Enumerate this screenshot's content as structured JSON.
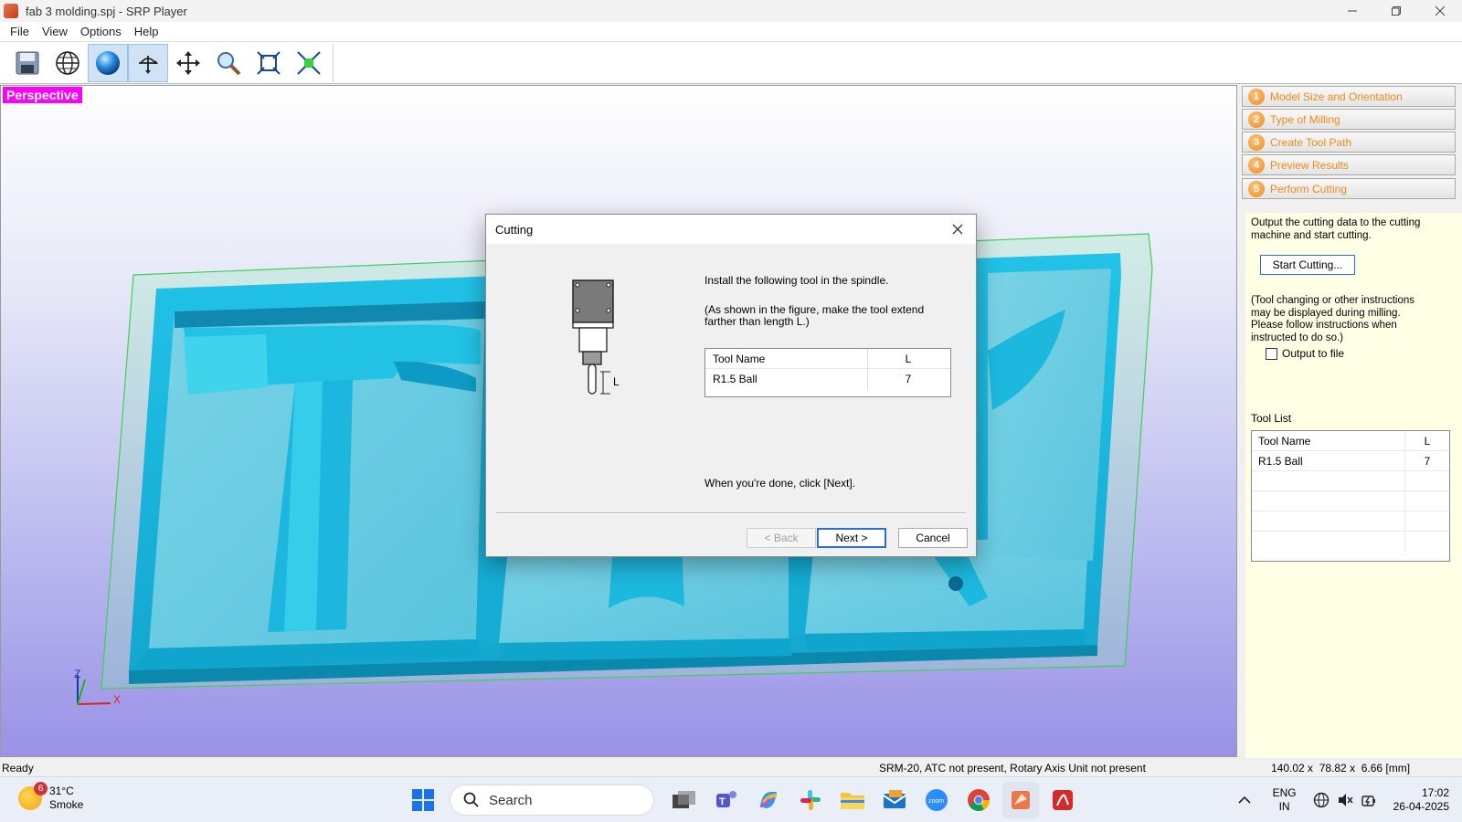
{
  "window": {
    "title": "fab 3 molding.spj - SRP Player"
  },
  "menu": [
    "File",
    "View",
    "Options",
    "Help"
  ],
  "toolbar": {
    "buttons": [
      "save-icon",
      "globe-icon",
      "sphere-render-icon",
      "rotate-view-icon",
      "pan-icon",
      "zoom-icon",
      "fit-all-icon",
      "fit-selection-icon"
    ]
  },
  "viewport": {
    "label": "Perspective"
  },
  "steps": [
    {
      "num": "1",
      "label": "Model Size and Orientation"
    },
    {
      "num": "2",
      "label": "Type of Milling"
    },
    {
      "num": "3",
      "label": "Create Tool Path"
    },
    {
      "num": "4",
      "label": "Preview Results"
    },
    {
      "num": "5",
      "label": "Perform Cutting"
    }
  ],
  "perform": {
    "intro": "Output the cutting data to the cutting machine and start cutting.",
    "start_button": "Start Cutting...",
    "note": "(Tool changing or other instructions may be displayed during milling. Please follow instructions when instructed to do so.)",
    "output_to_file": "Output to file",
    "tool_list_label": "Tool List",
    "tool_table": {
      "headers": [
        "Tool Name",
        "L"
      ],
      "rows": [
        [
          "R1.5 Ball",
          "7"
        ]
      ]
    }
  },
  "dialog": {
    "title": "Cutting",
    "line1": "Install the following tool in the spindle.",
    "line2": "(As shown in the figure, make the tool extend farther than length L.)",
    "figure_label": "L",
    "table": {
      "headers": [
        "Tool Name",
        "L"
      ],
      "rows": [
        [
          "R1.5 Ball",
          "7"
        ]
      ]
    },
    "done_text": "When you're done, click [Next].",
    "back": "< Back",
    "next": "Next >",
    "cancel": "Cancel"
  },
  "status": {
    "left": "Ready",
    "machine": "SRM-20, ATC not present, Rotary Axis Unit not present",
    "size": "140.02 x  78.82 x  6.66 [mm]"
  },
  "taskbar": {
    "weather_badge": "6",
    "temp": "31°C",
    "condition": "Smoke",
    "search": "Search",
    "lang1": "ENG",
    "lang2": "IN",
    "time": "17:02",
    "date": "26-04-2025"
  },
  "colors": {
    "accent": "#2a6fd6",
    "step_orange": "#f08a1c",
    "perspective": "#ff00ff",
    "model": "#1ab0d6"
  }
}
